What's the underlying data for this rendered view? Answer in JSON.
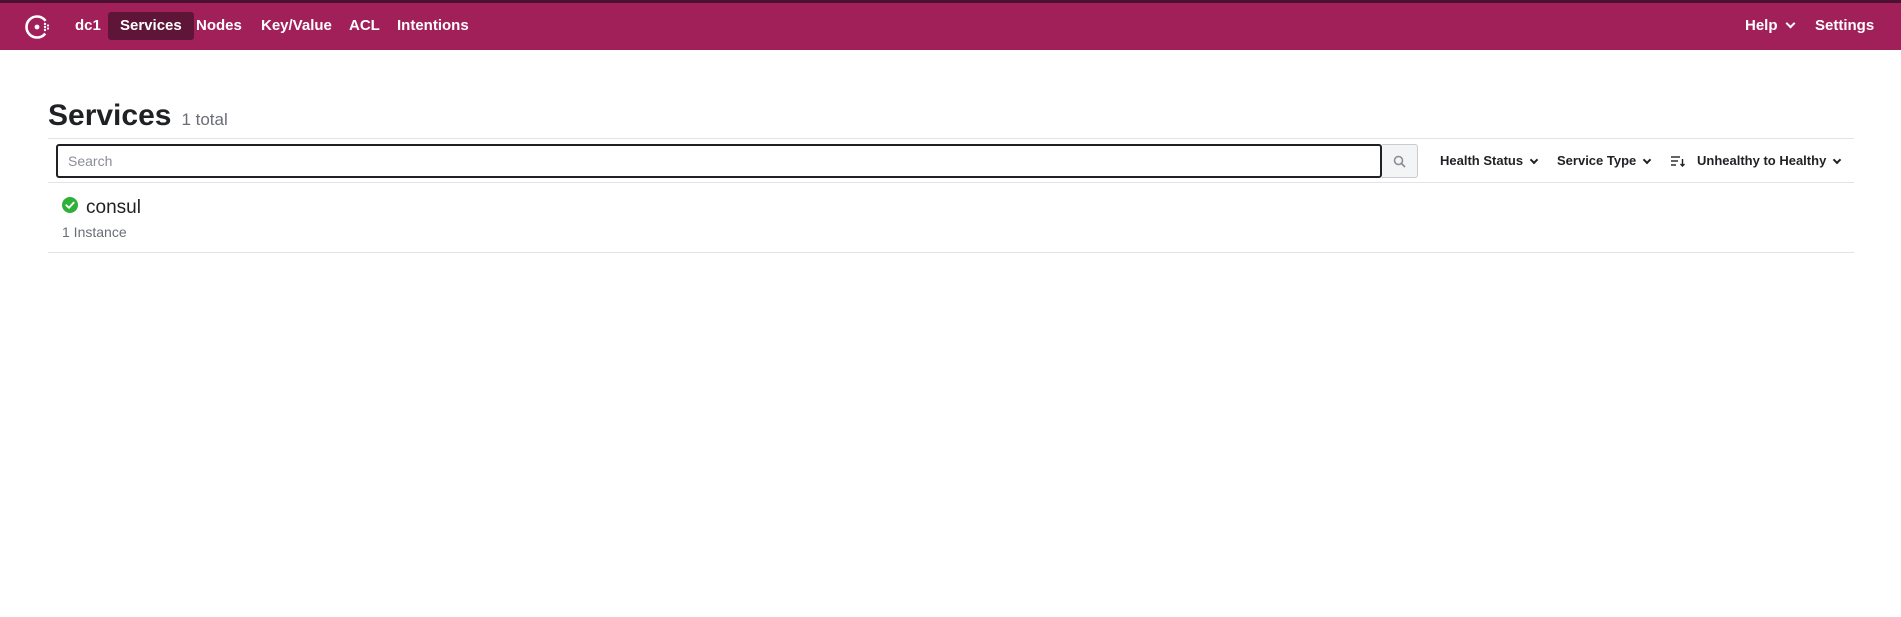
{
  "nav": {
    "datacenter": "dc1",
    "items": [
      {
        "label": "Services",
        "active": true
      },
      {
        "label": "Nodes"
      },
      {
        "label": "Key/Value"
      },
      {
        "label": "ACL"
      },
      {
        "label": "Intentions"
      }
    ],
    "help": "Help",
    "settings": "Settings"
  },
  "page": {
    "title": "Services",
    "total": "1 total"
  },
  "filters": {
    "search_placeholder": "Search",
    "search_value": "",
    "health_status": "Health Status",
    "service_type": "Service Type",
    "sort": "Unhealthy to Healthy"
  },
  "services": [
    {
      "name": "consul",
      "instances": "1 Instance",
      "status": "passing"
    }
  ],
  "colors": {
    "brand": "#a2205a",
    "brand_dark": "#5e1538",
    "passing": "#2eb039"
  },
  "icons": {
    "logo": "consul-logo-icon",
    "search": "search-icon",
    "sort": "sort-icon",
    "status": "check-circle-icon"
  }
}
